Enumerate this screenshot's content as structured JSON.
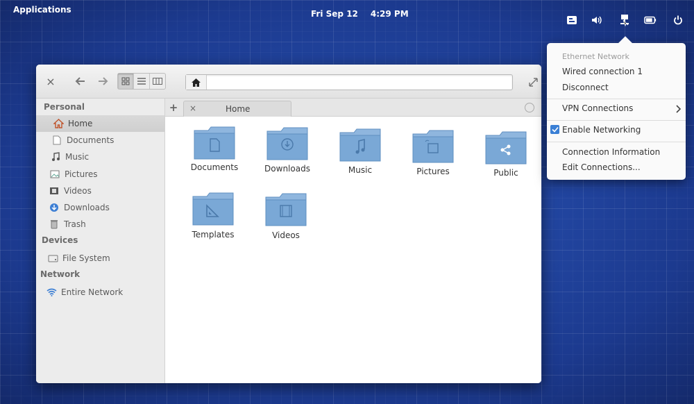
{
  "panel": {
    "applications": "Applications",
    "date": "Fri Sep 12",
    "time": "4:29 PM",
    "tray": [
      "keyboard-layout-icon",
      "volume-icon",
      "network-icon",
      "battery-icon",
      "power-icon"
    ]
  },
  "window": {
    "toolbar": {
      "close": "×",
      "back": "←",
      "forward": "→",
      "views": [
        "icon-view",
        "list-view",
        "column-view"
      ],
      "location_value": ""
    },
    "sidebar": {
      "sections": [
        {
          "title": "Personal",
          "items": [
            {
              "label": "Home",
              "icon": "home-icon"
            },
            {
              "label": "Documents",
              "icon": "document-icon"
            },
            {
              "label": "Music",
              "icon": "music-icon"
            },
            {
              "label": "Pictures",
              "icon": "pictures-icon"
            },
            {
              "label": "Videos",
              "icon": "video-icon"
            },
            {
              "label": "Downloads",
              "icon": "download-icon"
            },
            {
              "label": "Trash",
              "icon": "trash-icon"
            }
          ]
        },
        {
          "title": "Devices",
          "items": [
            {
              "label": "File System",
              "icon": "drive-icon"
            }
          ]
        },
        {
          "title": "Network",
          "items": [
            {
              "label": "Entire Network",
              "icon": "network-icon"
            }
          ]
        }
      ]
    },
    "tab": {
      "add": "+",
      "close": "×",
      "title": "Home"
    },
    "folders": [
      "Documents",
      "Downloads",
      "Music",
      "Pictures",
      "Public",
      "Templates",
      "Videos"
    ]
  },
  "network_menu": {
    "header": "Ethernet Network",
    "wired": "Wired connection 1",
    "disconnect": "Disconnect",
    "vpn": "VPN Connections",
    "enable": "Enable Networking",
    "info": "Connection Information",
    "edit": "Edit Connections...",
    "accent": "#3a7fd5"
  },
  "colors": {
    "desktop": "#1f3f96",
    "folder": "#7aa8d6"
  }
}
